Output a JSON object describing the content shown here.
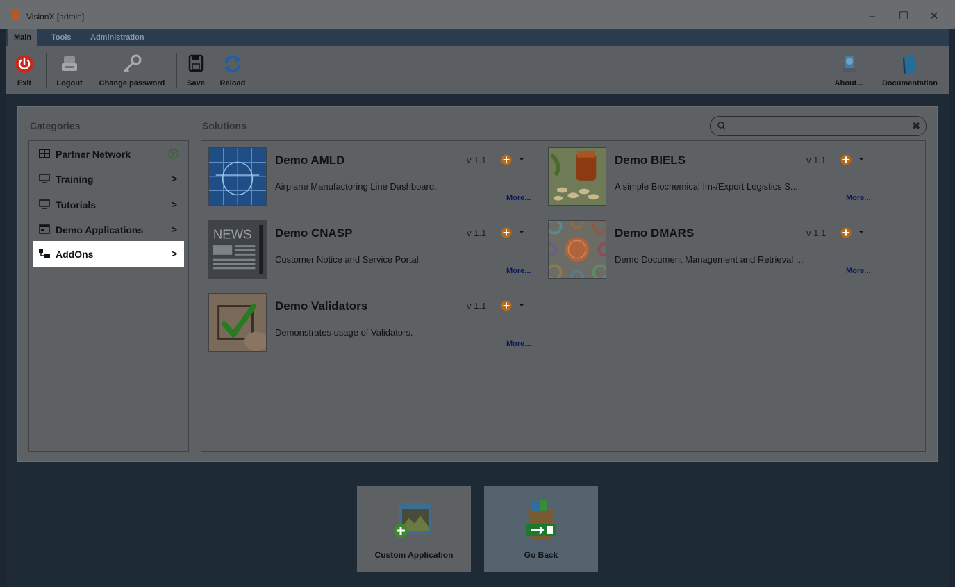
{
  "window": {
    "title": "VisionX [admin]",
    "minimize": "–",
    "maximize": "☐",
    "close": "✕"
  },
  "tabs": [
    {
      "label": "Main"
    },
    {
      "label": "Tools"
    },
    {
      "label": "Administration"
    }
  ],
  "toolbar": {
    "exit": "Exit",
    "logout": "Logout",
    "change_password": "Change password",
    "save": "Save",
    "reload": "Reload",
    "about": "About...",
    "documentation": "Documentation"
  },
  "categories_heading": "Categories",
  "solutions_heading": "Solutions",
  "search": {
    "placeholder": "",
    "clear": "✖"
  },
  "categories": [
    {
      "label": "Partner Network",
      "arrow": "›",
      "icon": "grid-icon"
    },
    {
      "label": "Training",
      "arrow": ">",
      "icon": "monitor-icon"
    },
    {
      "label": "Tutorials",
      "arrow": ">",
      "icon": "monitor-icon"
    },
    {
      "label": "Demo Applications",
      "arrow": ">",
      "icon": "window-icon"
    },
    {
      "label": "AddOns",
      "arrow": ">",
      "icon": "addons-icon"
    }
  ],
  "solutions": [
    {
      "name": "Demo AMLD",
      "version": "v 1.1",
      "description": "Airplane Manufactoring Line Dashboard.",
      "more": "More..."
    },
    {
      "name": "Demo BIELS",
      "version": "v 1.1",
      "description": "A simple Biochemical Im-/Export Logistics S...",
      "more": "More..."
    },
    {
      "name": "Demo CNASP",
      "version": "v 1.1",
      "description": "Customer Notice and Service Portal.",
      "more": "More..."
    },
    {
      "name": "Demo DMARS",
      "version": "v 1.1",
      "description": "Demo Document Management and Retrieval ...",
      "more": "More..."
    },
    {
      "name": "Demo Validators",
      "version": "v 1.1",
      "description": "Demonstrates usage of Validators.",
      "more": "More..."
    }
  ],
  "thumb_text": {
    "news": "NEWS"
  },
  "bottom": {
    "custom_application": "Custom Application",
    "go_back": "Go Back"
  },
  "colors": {
    "accent_orange": "#b86a1a",
    "selected_bg": "#ffffff",
    "exit_red": "#c22a1e"
  }
}
